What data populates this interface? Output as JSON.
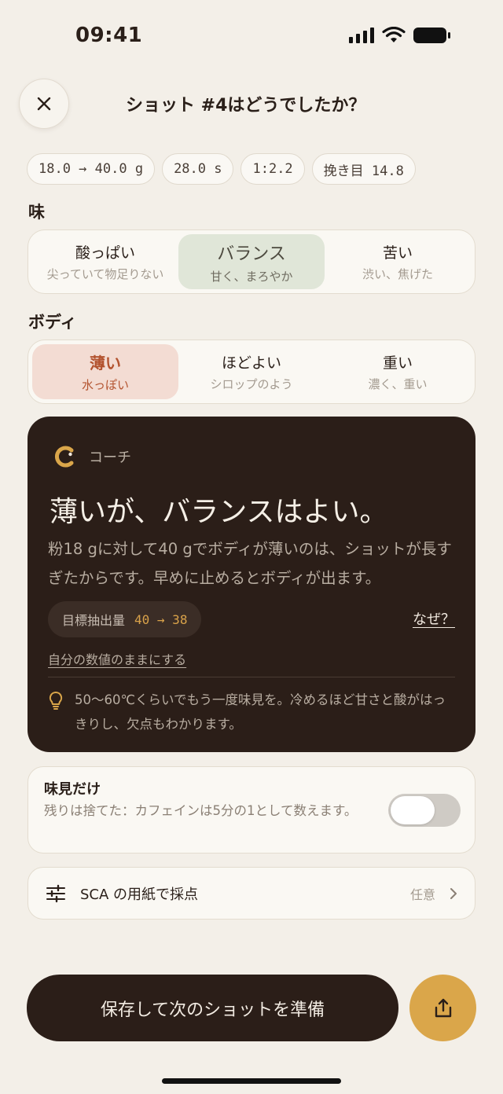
{
  "status": {
    "time": "09:41"
  },
  "header": {
    "title": "ショット #4はどうでしたか？"
  },
  "chips": [
    "18.0 → 40.0 g",
    "28.0 s",
    "1:2.2",
    "挽き目 14.8"
  ],
  "taste": {
    "label": "味",
    "options": [
      {
        "main": "酸っぱい",
        "sub": "尖っていて物足りない"
      },
      {
        "main": "バランス",
        "sub": "甘く、まろやか"
      },
      {
        "main": "苦い",
        "sub": "渋い、焦げた"
      }
    ],
    "selected": "バランス"
  },
  "body": {
    "label": "ボディ",
    "options": [
      {
        "main": "薄い",
        "sub": "水っぽい"
      },
      {
        "main": "ほどよい",
        "sub": "シロップのよう"
      },
      {
        "main": "重い",
        "sub": "濃く、重い"
      }
    ],
    "selected": "薄い"
  },
  "coach": {
    "label": "コーチ",
    "title": "薄いが、バランスはよい。",
    "body": "粉18 gに対して40 gでボディが薄いのは、ショットが長すぎたからです。早めに止めるとボディが出ます。",
    "target_label": "目標抽出量",
    "target_value": "40 → 38",
    "why": "なぜ？",
    "keep": "自分の数値のままにする",
    "tip": "50〜60℃くらいでもう一度味見を。冷めるほど甘さと酸がはっきりし、欠点もわかります。"
  },
  "taste_only": {
    "title": "味見だけ",
    "desc": "残りは捨てた：カフェインは5分の1として数えます。",
    "enabled": false
  },
  "sca": {
    "label": "SCA の用紙で採点",
    "meta": "任意"
  },
  "save": {
    "label": "保存して次のショットを準備"
  },
  "colors": {
    "accent": "#daa64a",
    "dark": "#2b1e18",
    "background": "#f3efe8",
    "rose": "#b3532f"
  }
}
